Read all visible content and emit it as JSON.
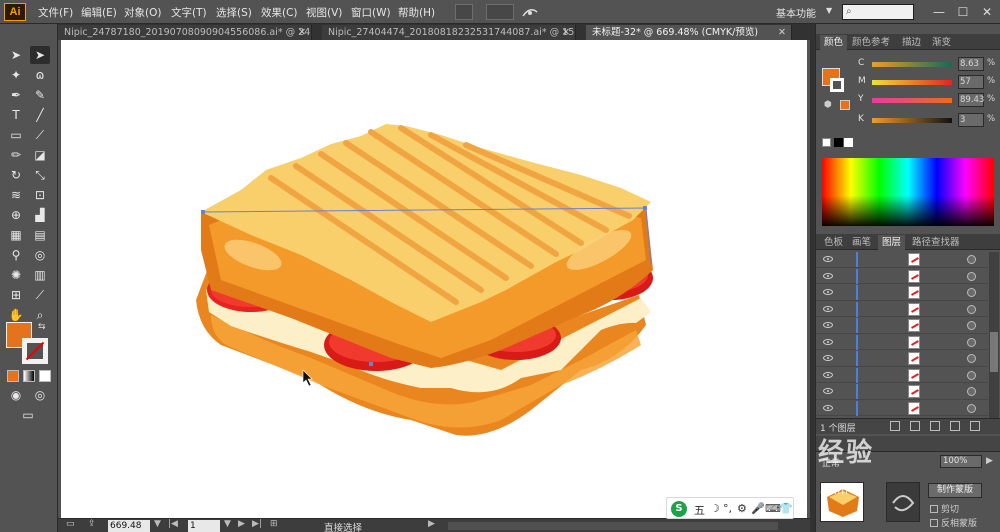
{
  "app": {
    "logo": "Ai",
    "menu": [
      "文件(F)",
      "编辑(E)",
      "对象(O)",
      "文字(T)",
      "选择(S)",
      "效果(C)",
      "视图(V)",
      "窗口(W)",
      "帮助(H)"
    ],
    "workspace": "基本功能",
    "window_controls": [
      "—",
      "☐",
      "✕"
    ]
  },
  "tabs": [
    {
      "label": "Nipic_24787180_20190708090904556086.ai* @ 24…",
      "active": false
    },
    {
      "label": "Nipic_27404474_20180818232531744087.ai* @ 15…",
      "active": false
    },
    {
      "label": "未标题-32* @ 669.48% (CMYK/预览)",
      "active": true
    }
  ],
  "tools": {
    "fill_color": "#e5731e",
    "stroke_color": "none"
  },
  "color_panel": {
    "tabs": [
      "颜色",
      "颜色参考",
      "描边",
      "渐变"
    ],
    "channels": [
      {
        "letter": "C",
        "value": "8.63",
        "unit": "%"
      },
      {
        "letter": "M",
        "value": "57",
        "unit": "%"
      },
      {
        "letter": "Y",
        "value": "89.43",
        "unit": "%"
      },
      {
        "letter": "K",
        "value": "3",
        "unit": "%"
      }
    ]
  },
  "layers_panel": {
    "tabs": [
      "色板",
      "画笔",
      "图层",
      "路径查找器"
    ],
    "row_count": 10,
    "count_label": "1 个图层"
  },
  "transparency_panel": {
    "blend_mode": "正常",
    "opacity": "100%",
    "make_mask_label": "制作蒙版",
    "clip_label": "剪切",
    "invert_label": "反相蒙版"
  },
  "status": {
    "zoom": "669.48",
    "page": "1",
    "tool_name": "直接选择"
  },
  "ime": {
    "logo": "S",
    "glyphs": [
      "五",
      "☽",
      "°,",
      "⚙",
      "🎤",
      "⌨",
      "👕",
      "▦"
    ]
  },
  "watermark": {
    "text": "经验",
    "sub": "an.m"
  },
  "colors": {
    "toast_top": "#f8cf6a",
    "toast_stripe": "#f0a542",
    "crust": "#e27a17",
    "crust_light": "#f39a2b",
    "tomato": "#e8231f",
    "cheese": "#fdf0c8"
  }
}
